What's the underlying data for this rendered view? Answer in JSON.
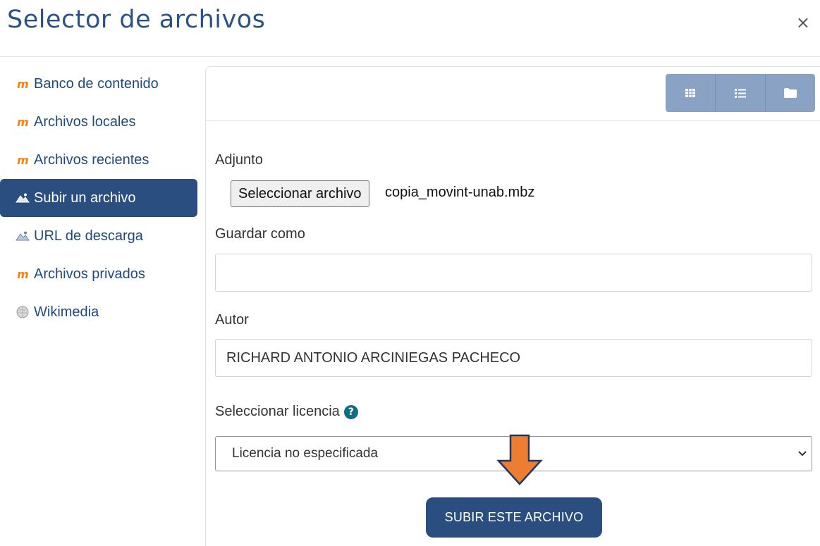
{
  "dialog": {
    "title": "Selector de archivos",
    "close_symbol": "×"
  },
  "sidebar": {
    "items": [
      {
        "label": "Banco de contenido",
        "icon": "moodle-icon",
        "active": false
      },
      {
        "label": "Archivos locales",
        "icon": "moodle-icon",
        "active": false
      },
      {
        "label": "Archivos recientes",
        "icon": "moodle-icon",
        "active": false
      },
      {
        "label": "Subir un archivo",
        "icon": "upload-icon",
        "active": true
      },
      {
        "label": "URL de descarga",
        "icon": "download-url-icon",
        "active": false
      },
      {
        "label": "Archivos privados",
        "icon": "moodle-icon",
        "active": false
      },
      {
        "label": "Wikimedia",
        "icon": "wikimedia-globe-icon",
        "active": false
      }
    ]
  },
  "toolbar": {
    "views": [
      {
        "icon": "grid-view-icon"
      },
      {
        "icon": "list-view-icon"
      },
      {
        "icon": "folder-view-icon"
      }
    ]
  },
  "form": {
    "attachment_label": "Adjunto",
    "choose_file_label": "Seleccionar archivo",
    "chosen_file": "copia_movint-unab.mbz",
    "save_as_label": "Guardar como",
    "save_as_value": "",
    "author_label": "Autor",
    "author_value": "RICHARD ANTONIO ARCINIEGAS PACHECO",
    "license_label": "Seleccionar licencia",
    "help_symbol": "?",
    "license_value": "Licencia no especificada",
    "submit_label": "SUBIR ESTE ARCHIVO"
  },
  "colors": {
    "primary": "#2a4e7f",
    "view_buttons": "#8aa3c5",
    "moodle_orange": "#f98012",
    "annotation_arrow": "#ed7d31"
  }
}
